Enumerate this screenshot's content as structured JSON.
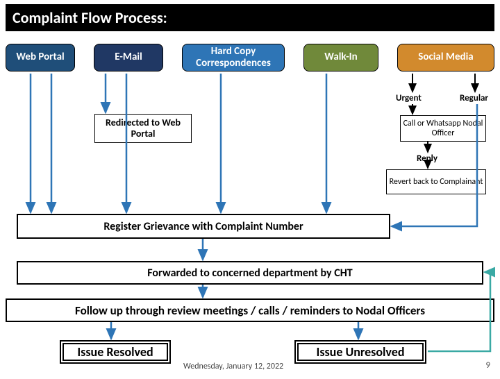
{
  "title": "Complaint Flow Process:",
  "channels": {
    "web": "Web Portal",
    "email": "E-Mail",
    "hard": "Hard Copy Correspondences",
    "walk": "Walk-In",
    "social": "Social Media"
  },
  "redirected": "Redirected to Web Portal",
  "labels": {
    "urgent": "Urgent",
    "regular": "Regular",
    "reply": "Reply"
  },
  "call_nodal": "Call or Whatsapp Nodal Officer",
  "revert": "Revert back to Complainant",
  "steps": {
    "register": "Register Grievance with Complaint Number",
    "forward": "Forwarded to concerned department by CHT",
    "followup": "Follow up through review meetings / calls / reminders to Nodal Officers",
    "resolved": "Issue Resolved",
    "unresolved": "Issue Unresolved"
  },
  "footer": {
    "date": "Wednesday, January 12, 2022",
    "page": "9"
  },
  "colors": {
    "web": "#1f4e79",
    "email": "#203864",
    "hard": "#2e75b6",
    "walk": "#70893a",
    "social": "#d28a2d",
    "arrow_blue": "#2e75b6",
    "arrow_teal": "#3aa9a4"
  },
  "chart_data": {
    "type": "diagram",
    "title": "Complaint Flow Process",
    "nodes": [
      {
        "id": "web",
        "label": "Web Portal",
        "kind": "input"
      },
      {
        "id": "email",
        "label": "E-Mail",
        "kind": "input"
      },
      {
        "id": "hard",
        "label": "Hard Copy Correspondences",
        "kind": "input"
      },
      {
        "id": "walk",
        "label": "Walk-In",
        "kind": "input"
      },
      {
        "id": "social",
        "label": "Social Media",
        "kind": "input"
      },
      {
        "id": "redirect",
        "label": "Redirected to Web Portal",
        "kind": "process"
      },
      {
        "id": "urgent",
        "label": "Urgent",
        "kind": "label"
      },
      {
        "id": "regular",
        "label": "Regular",
        "kind": "label"
      },
      {
        "id": "callnodal",
        "label": "Call or Whatsapp Nodal Officer",
        "kind": "process"
      },
      {
        "id": "reply",
        "label": "Reply",
        "kind": "label"
      },
      {
        "id": "revert",
        "label": "Revert back to Complainant",
        "kind": "process"
      },
      {
        "id": "register",
        "label": "Register Grievance with Complaint Number",
        "kind": "process"
      },
      {
        "id": "forward",
        "label": "Forwarded to concerned department by CHT",
        "kind": "process"
      },
      {
        "id": "followup",
        "label": "Follow up through review meetings / calls / reminders to Nodal Officers",
        "kind": "process"
      },
      {
        "id": "resolved",
        "label": "Issue Resolved",
        "kind": "terminal"
      },
      {
        "id": "unresolved",
        "label": "Issue Unresolved",
        "kind": "terminal"
      }
    ],
    "edges": [
      {
        "from": "web",
        "to": "register"
      },
      {
        "from": "email",
        "to": "redirect"
      },
      {
        "from": "email",
        "to": "register"
      },
      {
        "from": "hard",
        "to": "register"
      },
      {
        "from": "walk",
        "to": "register"
      },
      {
        "from": "social",
        "to": "urgent"
      },
      {
        "from": "social",
        "to": "regular"
      },
      {
        "from": "urgent",
        "to": "callnodal"
      },
      {
        "from": "callnodal",
        "to": "reply"
      },
      {
        "from": "reply",
        "to": "revert"
      },
      {
        "from": "regular",
        "to": "register"
      },
      {
        "from": "register",
        "to": "forward"
      },
      {
        "from": "forward",
        "to": "followup"
      },
      {
        "from": "followup",
        "to": "resolved"
      },
      {
        "from": "followup",
        "to": "unresolved"
      },
      {
        "from": "unresolved",
        "to": "forward"
      }
    ]
  }
}
